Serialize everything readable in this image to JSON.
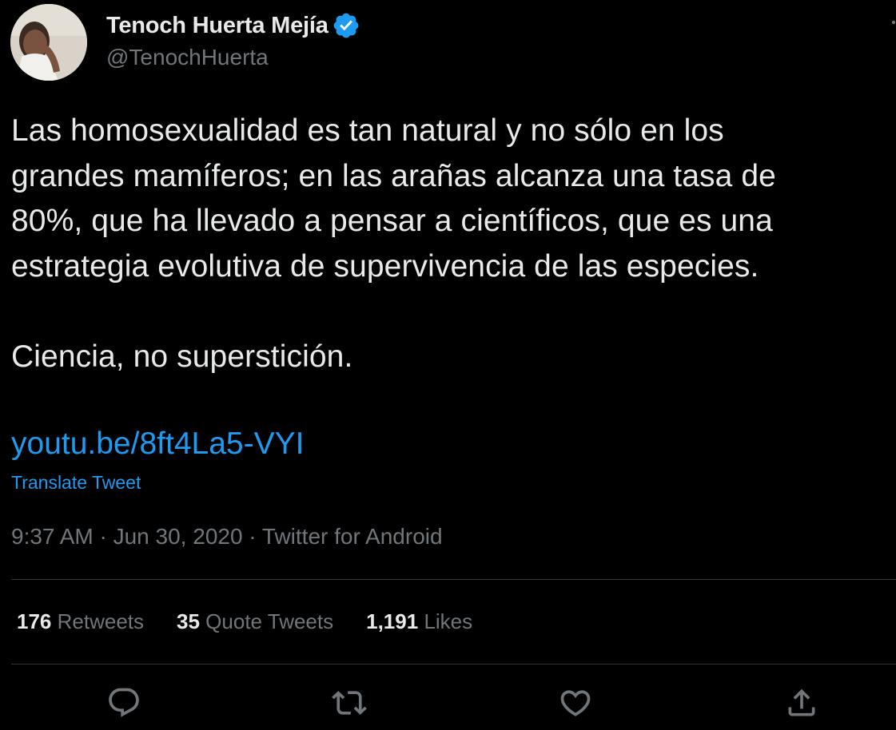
{
  "author": {
    "name": "Tenoch Huerta Mejía",
    "handle": "@TenochHuerta",
    "verified": true
  },
  "tweet": {
    "lines": [
      "Las homosexualidad es tan natural y no sólo en los",
      "grandes mamíferos; en las arañas alcanza una tasa de",
      "80%, que ha llevado a pensar a científicos,  que es una",
      "estrategia evolutiva de supervivencia de las especies.",
      "Ciencia, no superstición."
    ],
    "link": "youtu.be/8ft4La5-VYI",
    "translate_label": "Translate Tweet",
    "meta": "9:37 AM · Jun 30, 2020 · Twitter for Android"
  },
  "stats": {
    "retweets": {
      "count": "176",
      "label": "Retweets"
    },
    "quotes": {
      "count": "35",
      "label": "Quote Tweets"
    },
    "likes": {
      "count": "1,191",
      "label": "Likes"
    }
  },
  "icons": {
    "verified": "verified-badge-icon",
    "more": "more-icon",
    "reply": "reply-icon",
    "retweet": "retweet-icon",
    "like": "like-icon",
    "share": "share-icon"
  },
  "colors": {
    "background": "#000000",
    "text": "#e7e9ea",
    "secondary": "#71767b",
    "accent": "#1d9bf0",
    "divider": "#2f3336"
  }
}
